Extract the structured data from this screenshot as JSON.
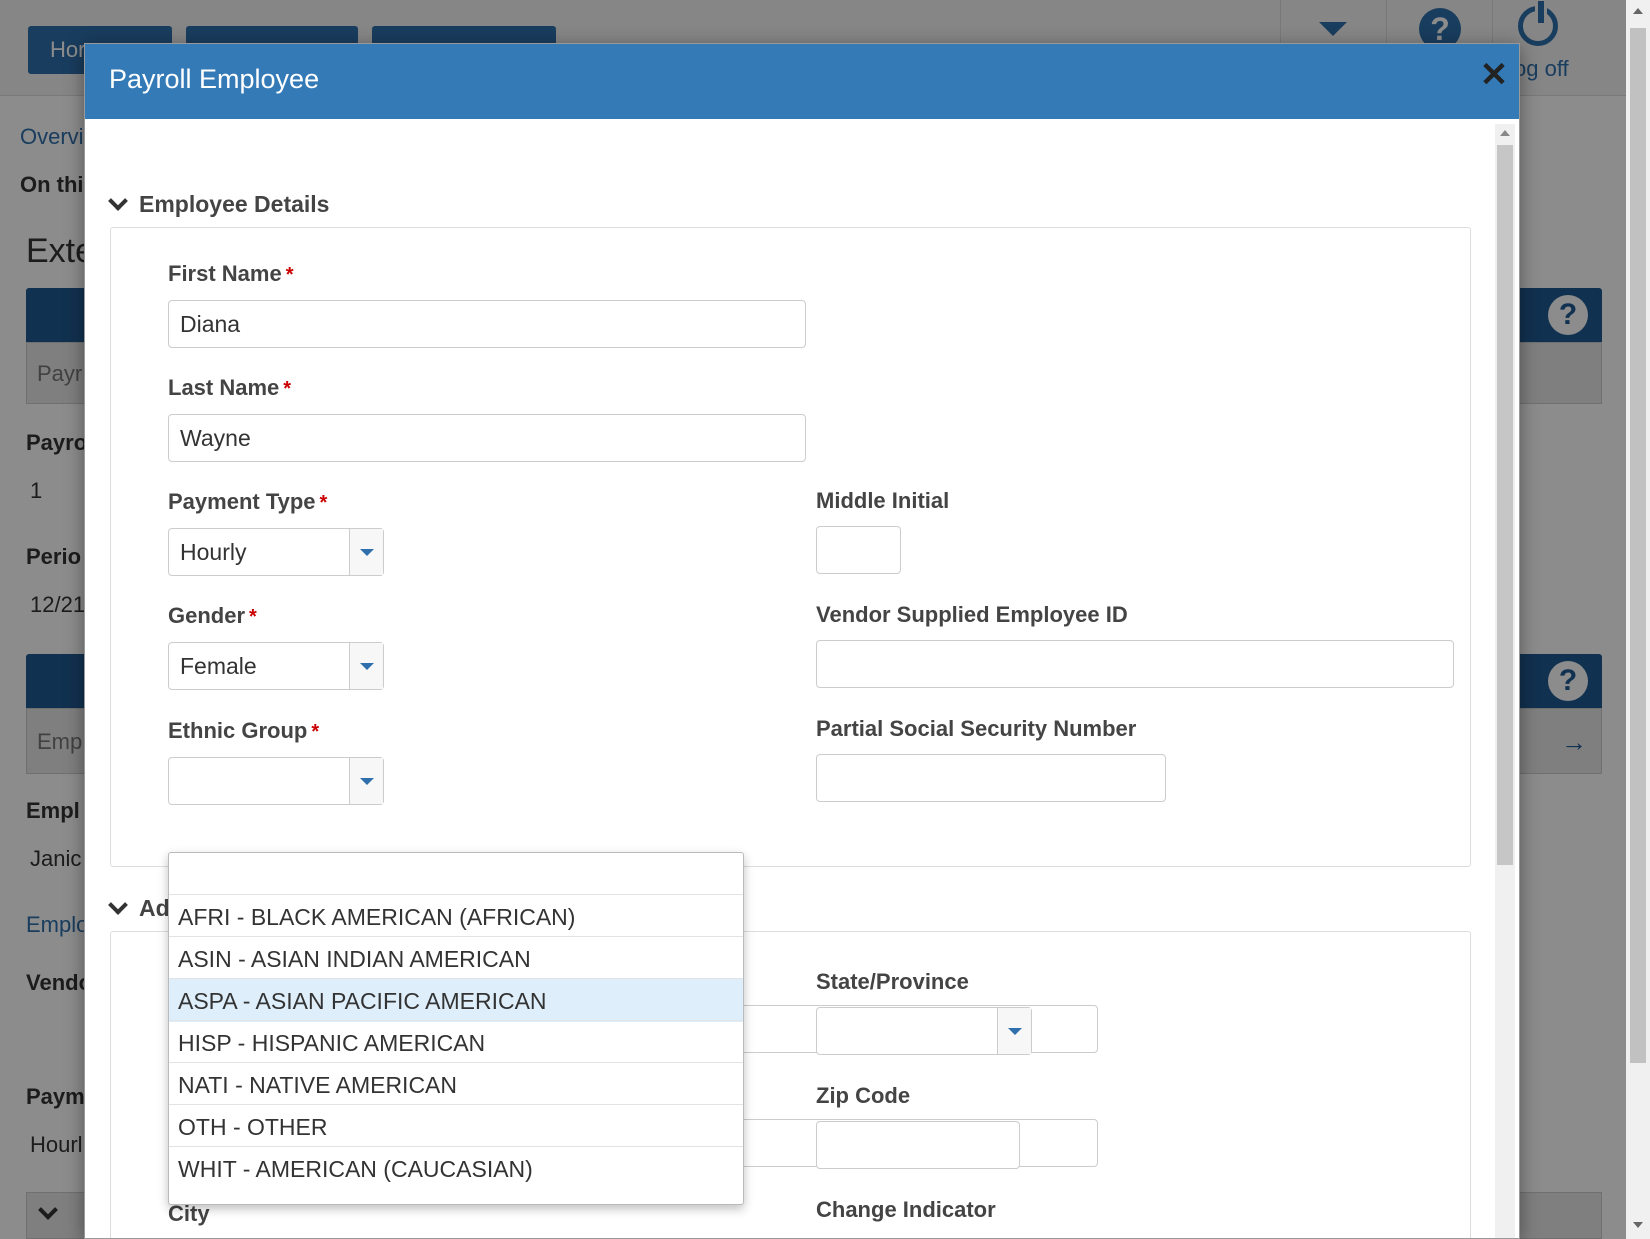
{
  "background": {
    "nav": {
      "home": "Hor",
      "btn2": "",
      "btn3": ""
    },
    "logoff": "og off",
    "overview_link": "Overvi",
    "on_this": "On thi",
    "heading": "Exte",
    "panel1_body": "Payr",
    "payroll_label": "Payro",
    "payroll_value": "1",
    "period_label": "Perio",
    "period_value": "12/21",
    "panel2_body": "Emp",
    "employee_label": "Empl",
    "employee_value": "Janic",
    "employee_link": "Emplo",
    "vendor_label": "Vendo",
    "payment_label": "Paym",
    "payment_value": "Hourl"
  },
  "modal": {
    "title": "Payroll Employee",
    "close": "✕",
    "section_employee": "Employee Details",
    "section_address": "Ad",
    "fields": {
      "first_name": {
        "label": "First Name",
        "value": "Diana"
      },
      "last_name": {
        "label": "Last Name",
        "value": "Wayne"
      },
      "payment_type": {
        "label": "Payment Type",
        "value": "Hourly"
      },
      "middle_initial": {
        "label": "Middle Initial",
        "value": ""
      },
      "gender": {
        "label": "Gender",
        "value": "Female"
      },
      "vendor_employee_id": {
        "label": "Vendor Supplied Employee ID",
        "value": ""
      },
      "ethnic_group": {
        "label": "Ethnic Group",
        "value": ""
      },
      "partial_ssn": {
        "label": "Partial Social Security Number",
        "value": ""
      },
      "state": {
        "label": "State/Province",
        "value": ""
      },
      "zip": {
        "label": "Zip Code",
        "value": ""
      },
      "city": {
        "label": "City"
      },
      "change_indicator": {
        "label": "Change Indicator"
      }
    },
    "required_mark": "*",
    "ethnic_options": [
      "",
      "AFRI - BLACK AMERICAN (AFRICAN)",
      "ASIN - ASIAN INDIAN AMERICAN",
      "ASPA - ASIAN PACIFIC AMERICAN",
      "HISP - HISPANIC AMERICAN",
      "NATI - NATIVE AMERICAN",
      "OTH - OTHER",
      "WHIT - AMERICAN (CAUCASIAN)"
    ],
    "highlighted_option": "ASPA - ASIAN PACIFIC AMERICAN"
  },
  "colors": {
    "header_blue": "#337ab7",
    "required": "#cc0000",
    "highlight": "#deeefb"
  }
}
